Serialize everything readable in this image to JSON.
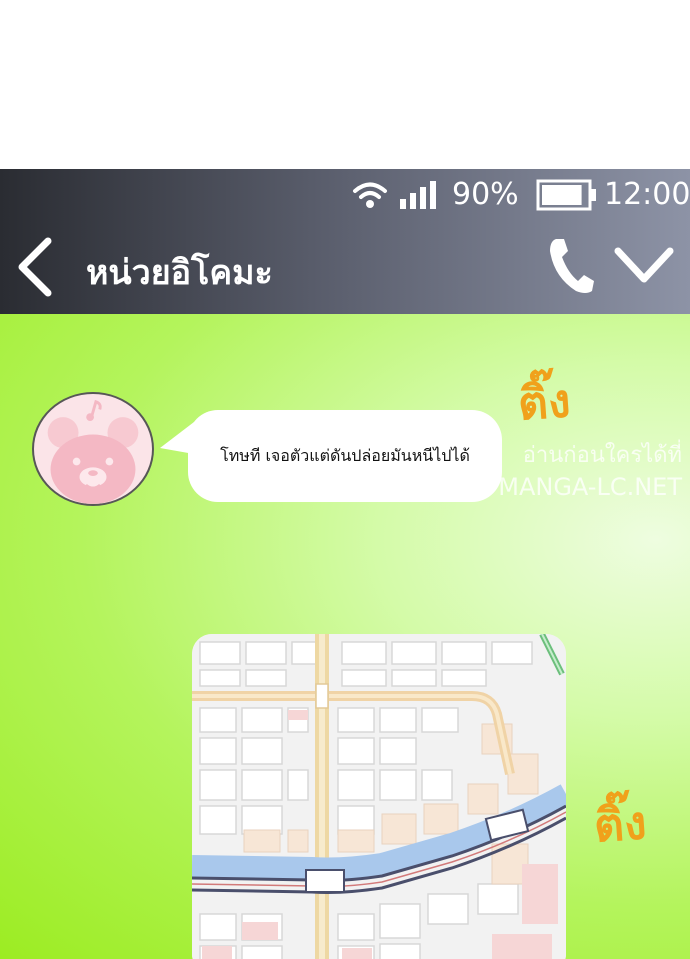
{
  "status_bar": {
    "battery_percent": "90%",
    "time": "12:00",
    "battery_level": 0.9,
    "icons": [
      "wifi-icon",
      "signal-icon",
      "battery-icon"
    ]
  },
  "header": {
    "title": "หน่วยอิโคมะ",
    "icons": [
      "back-arrow-icon",
      "phone-icon",
      "chevron-down-icon"
    ]
  },
  "chat": {
    "message": "โทษที เจอตัวแต่ดันปล่อยมันหนีไปได้",
    "sfx_1": "ติ๊ง",
    "sfx_2": "ติ๊ง",
    "watermark_line1": "อ่านก่อนใครได้ที่",
    "watermark_line2": "MANGA-LC.NET"
  },
  "colors": {
    "header_dark": "#2a2c32",
    "header_light": "#8d93a6",
    "chat_green": "#9cec22",
    "sfx_orange": "#f0a11b",
    "avatar_pink": "#fbe4e8"
  }
}
